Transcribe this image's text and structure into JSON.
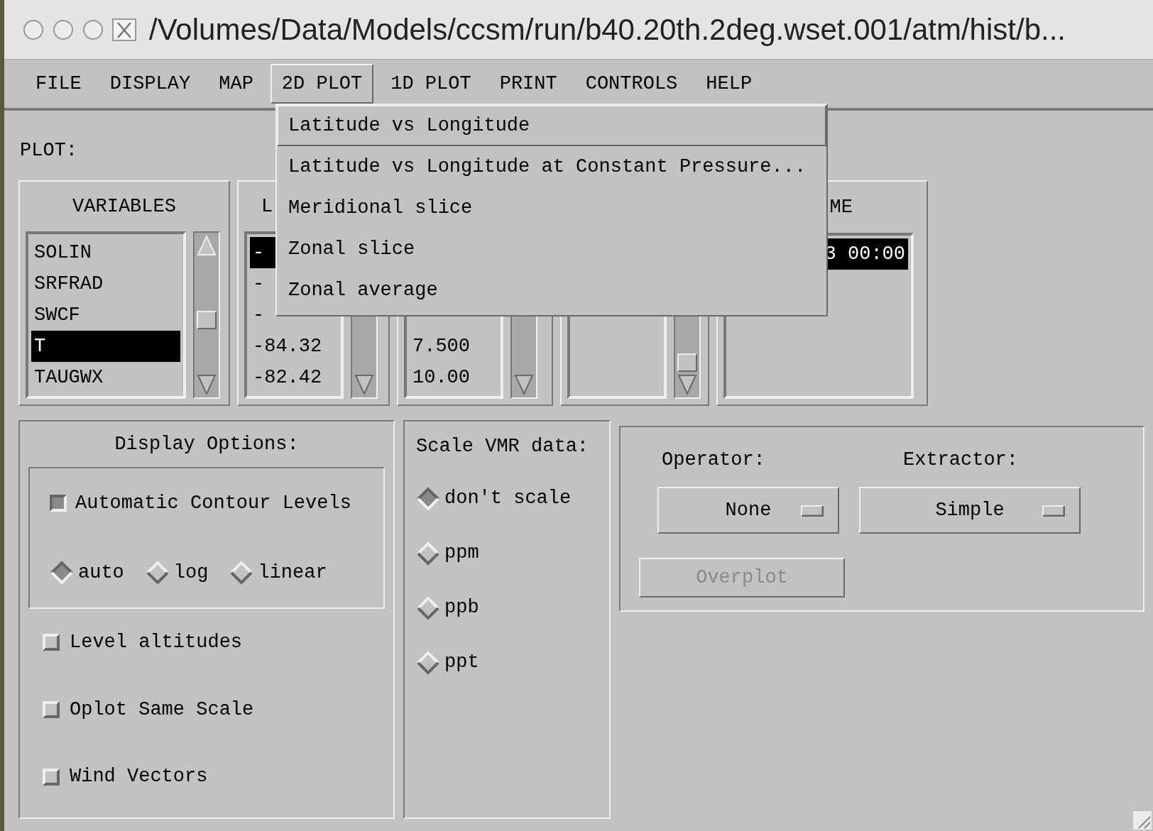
{
  "window": {
    "title": "/Volumes/Data/Models/ccsm/run/b40.20th.2deg.wset.001/atm/hist/b..."
  },
  "menu_bar": [
    {
      "label": "FILE",
      "selected": false
    },
    {
      "label": "DISPLAY",
      "selected": false
    },
    {
      "label": "MAP",
      "selected": false
    },
    {
      "label": "2D PLOT",
      "selected": true
    },
    {
      "label": "1D PLOT",
      "selected": false
    },
    {
      "label": "PRINT",
      "selected": false
    },
    {
      "label": "CONTROLS",
      "selected": false
    },
    {
      "label": "HELP",
      "selected": false
    }
  ],
  "dropdown": [
    {
      "label": "Latitude vs Longitude",
      "selected": true
    },
    {
      "label": "Latitude vs Longitude at Constant Pressure...",
      "selected": false
    },
    {
      "label": "Meridional slice",
      "selected": false
    },
    {
      "label": "Zonal slice",
      "selected": false
    },
    {
      "label": "Zonal average",
      "selected": false
    }
  ],
  "plot_label": "PLOT:",
  "lists": [
    {
      "kind": "scroll",
      "header": "VARIABLES",
      "items": [
        {
          "text": "SOLIN",
          "selected": false
        },
        {
          "text": "SRFRAD",
          "selected": false
        },
        {
          "text": "SWCF",
          "selected": false
        },
        {
          "text": "T",
          "selected": true
        },
        {
          "text": "TAUGWX",
          "selected": false
        }
      ]
    },
    {
      "kind": "scroll",
      "header": "L",
      "items": [
        {
          "text": "-",
          "selected": true
        },
        {
          "text": "-",
          "selected": false
        },
        {
          "text": "-",
          "selected": false
        },
        {
          "text": "-84.32",
          "selected": false
        },
        {
          "text": "-82.42",
          "selected": false
        }
      ]
    },
    {
      "kind": "scroll",
      "items": [
        {
          "text": "7.500",
          "selected": false
        },
        {
          "text": "10.00",
          "selected": false
        }
      ]
    },
    {
      "kind": "scroll"
    },
    {
      "kind": "plain",
      "header": "ME",
      "items": [
        {
          "text": "3 00:00",
          "selected": true
        }
      ]
    }
  ],
  "display_options": {
    "title": "Display Options:",
    "contour": {
      "label": "Automatic Contour Levels",
      "checked": true
    },
    "modes": [
      {
        "label": "auto",
        "selected": true
      },
      {
        "label": "log",
        "selected": false
      },
      {
        "label": "linear",
        "selected": false
      }
    ],
    "options": [
      {
        "label": "Level altitudes",
        "checked": false
      },
      {
        "label": "Oplot Same Scale",
        "checked": false
      },
      {
        "label": "Wind Vectors",
        "checked": false
      }
    ]
  },
  "scale_vmr": {
    "title": "Scale VMR data:",
    "options": [
      {
        "label": "don't scale",
        "selected": true
      },
      {
        "label": "ppm",
        "selected": false
      },
      {
        "label": "ppb",
        "selected": false
      },
      {
        "label": "ppt",
        "selected": false
      }
    ]
  },
  "operator": {
    "label": "Operator:",
    "value": "None"
  },
  "extractor": {
    "label": "Extractor:",
    "value": "Simple"
  },
  "overplot": {
    "label": "Overplot",
    "disabled": true
  }
}
